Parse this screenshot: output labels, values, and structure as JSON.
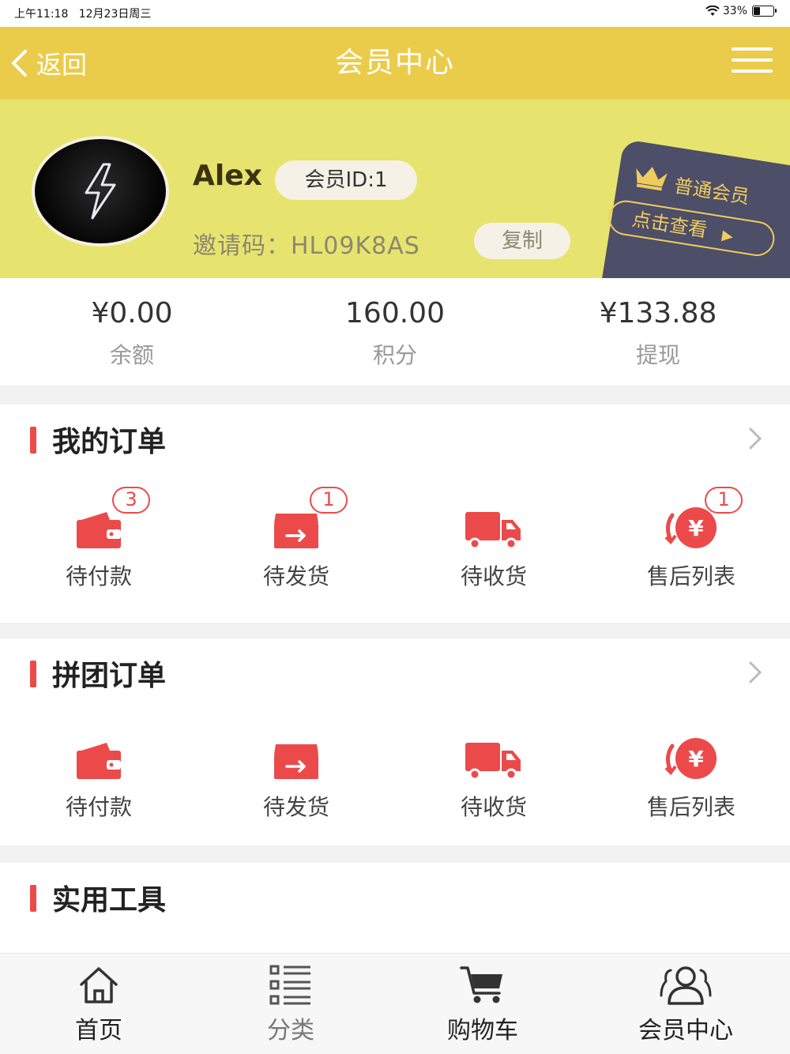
{
  "status_bar": {
    "time": "上午11:18",
    "date": "12月23日周三",
    "battery": "33%"
  },
  "nav": {
    "back_label": "返回",
    "title": "会员中心"
  },
  "profile": {
    "username": "Alex",
    "member_id": "会员ID:1",
    "invite_label": "邀请码：",
    "invite_code": "HL09K8AS",
    "copy_label": "复制",
    "vip_level": "普通会员",
    "vip_view": "点击查看"
  },
  "stats": [
    {
      "value": "¥0.00",
      "label": "余额"
    },
    {
      "value": "160.00",
      "label": "积分"
    },
    {
      "value": "¥133.88",
      "label": "提现"
    }
  ],
  "my_orders": {
    "title": "我的订单",
    "items": [
      {
        "label": "待付款",
        "badge": "3",
        "icon": "wallet-icon"
      },
      {
        "label": "待发货",
        "badge": "1",
        "icon": "ship-box-icon"
      },
      {
        "label": "待收货",
        "badge": "",
        "icon": "truck-icon"
      },
      {
        "label": "售后列表",
        "badge": "1",
        "icon": "refund-icon"
      }
    ]
  },
  "group_orders": {
    "title": "拼团订单",
    "items": [
      {
        "label": "待付款",
        "icon": "wallet-icon"
      },
      {
        "label": "待发货",
        "icon": "ship-box-icon"
      },
      {
        "label": "待收货",
        "icon": "truck-icon"
      },
      {
        "label": "售后列表",
        "icon": "refund-icon"
      }
    ]
  },
  "tools": {
    "title": "实用工具"
  },
  "tabbar": [
    {
      "label": "首页",
      "icon": "home-icon"
    },
    {
      "label": "分类",
      "icon": "list-icon"
    },
    {
      "label": "购物车",
      "icon": "cart-icon"
    },
    {
      "label": "会员中心",
      "icon": "user-group-icon"
    }
  ],
  "colors": {
    "nav_bg": "#ebcc4a",
    "header_bg": "#e6e46e",
    "accent_red": "#ec4a4a",
    "vip_card": "#4d4e68",
    "vip_gold": "#f0cb5d"
  }
}
